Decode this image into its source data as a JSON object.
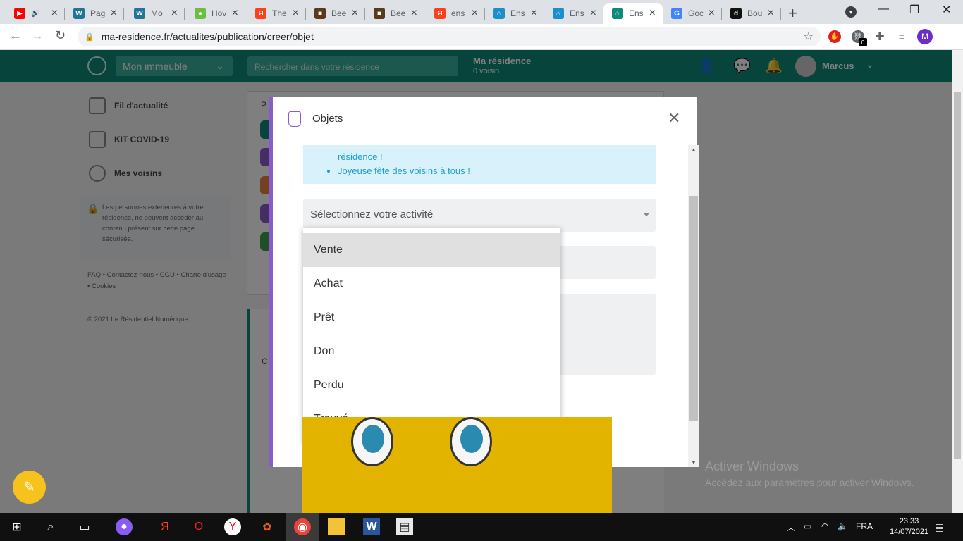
{
  "browser": {
    "tabs": [
      {
        "title": "",
        "fav_color": "#ff0000",
        "fav_glyph": "▶"
      },
      {
        "title": "Pag",
        "fav_color": "#21759b",
        "fav_glyph": "W"
      },
      {
        "title": "Mo",
        "fav_color": "#21759b",
        "fav_glyph": "W"
      },
      {
        "title": "Hov",
        "fav_color": "#6abf40",
        "fav_glyph": "●"
      },
      {
        "title": "The",
        "fav_color": "#fc3f1d",
        "fav_glyph": "Я"
      },
      {
        "title": "Bee",
        "fav_color": "#5a3a1a",
        "fav_glyph": "■"
      },
      {
        "title": "Bee",
        "fav_color": "#5a3a1a",
        "fav_glyph": "■"
      },
      {
        "title": "ens",
        "fav_color": "#fc3f1d",
        "fav_glyph": "Я"
      },
      {
        "title": "Ens",
        "fav_color": "#1a8fc9",
        "fav_glyph": "⌂"
      },
      {
        "title": "Ens",
        "fav_color": "#1a8fc9",
        "fav_glyph": "⌂"
      },
      {
        "title": "Ens",
        "fav_color": "#0e8a78",
        "fav_glyph": "⌂"
      },
      {
        "title": "Goc",
        "fav_color": "#4285f4",
        "fav_glyph": "G"
      },
      {
        "title": "Bou",
        "fav_color": "#111111",
        "fav_glyph": "d"
      }
    ],
    "url": "ma-residence.fr/actualites/publication/creer/objet",
    "profile_initial": "M",
    "ext_badge": "0"
  },
  "app": {
    "building_select": "Mon immeuble",
    "search_placeholder": "Rechercher dans votre résidence",
    "residence_title": "Ma résidence",
    "residence_sub": "0 voisin",
    "user_name": "Marcus",
    "sidebar": [
      {
        "label": "Fil d'actualité"
      },
      {
        "label": "KIT COVID-19"
      },
      {
        "label": "Mes voisins"
      }
    ],
    "notice": "Les personnes exterieures à votre résidence, ne peuvent accéder au contenu présent sur cette page sécurisée.",
    "footer_links": "FAQ • Contactez-nous • CGU • Charte d'usage • Cookies",
    "copyright": "© 2021 Le Résidentiel Numérique",
    "card_stub_p": "P",
    "card_stub_c": "C"
  },
  "modal": {
    "title": "Objets",
    "info_line1": "résidence !",
    "info_line2": "Joyeuse fête des voisins à tous !",
    "select_placeholder": "Sélectionnez votre activité",
    "options": [
      "Vente",
      "Achat",
      "Prêt",
      "Don",
      "Perdu",
      "Trouvé"
    ],
    "highlighted_option": "Vente"
  },
  "watermark": {
    "line1": "Activer Windows",
    "line2": "Accédez aux paramètres pour activer Windows."
  },
  "taskbar": {
    "lang": "FRA",
    "time": "23:33",
    "date": "14/07/2021"
  }
}
